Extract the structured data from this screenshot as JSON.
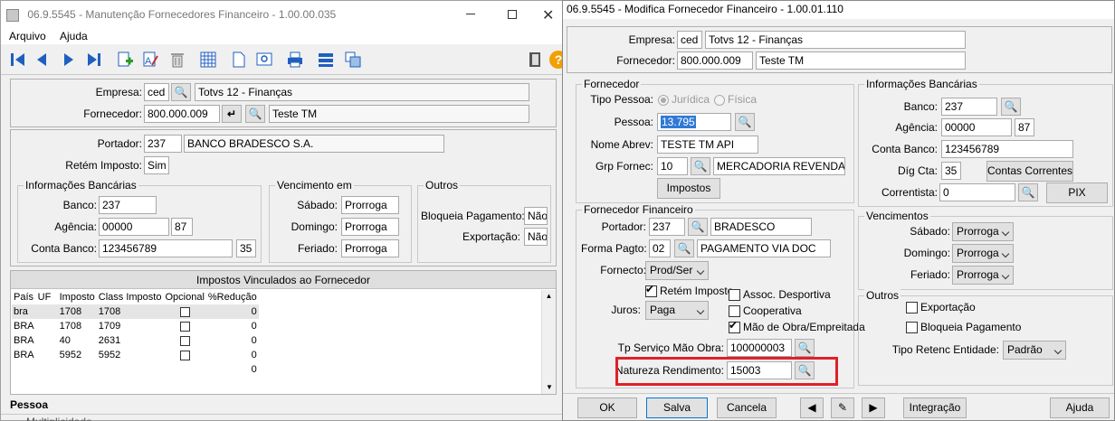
{
  "left": {
    "title": "06.9.5545 - Manutenção Fornecedores Financeiro - 1.00.00.035",
    "menu": [
      "Arquivo",
      "Ajuda"
    ],
    "empresa": {
      "label": "Empresa:",
      "code": "ced",
      "name": "Totvs 12 - Finanças"
    },
    "fornecedor": {
      "label": "Fornecedor:",
      "code": "800.000.009",
      "name": "Teste TM"
    },
    "portador": {
      "label": "Portador:",
      "code": "237",
      "name": "BANCO BRADESCO S.A."
    },
    "retem": {
      "label": "Retém Imposto:",
      "value": "Sim"
    },
    "info_bancarias": {
      "title": "Informações Bancárias",
      "banco_label": "Banco:",
      "banco": "237",
      "agencia_label": "Agência:",
      "agencia": "00000",
      "agencia_dv": "87",
      "conta_label": "Conta Banco:",
      "conta": "123456789",
      "conta_dv": "35"
    },
    "vencimento": {
      "title": "Vencimento em",
      "sabado_label": "Sábado:",
      "sabado": "Prorroga",
      "domingo_label": "Domingo:",
      "domingo": "Prorroga",
      "feriado_label": "Feriado:",
      "feriado": "Prorroga"
    },
    "outros": {
      "title": "Outros",
      "bloqueia_label": "Bloqueia Pagamento:",
      "bloqueia": "Não",
      "exportacao_label": "Exportação:",
      "exportacao": "Não"
    },
    "impostos": {
      "title": "Impostos Vinculados ao Fornecedor",
      "headers": [
        "País",
        "UF",
        "Imposto",
        "Class Imposto",
        "Opcional",
        "%Redução"
      ],
      "rows": [
        {
          "pais": "bra",
          "uf": "",
          "imposto": "1708",
          "classe": "1708",
          "reducao": "0"
        },
        {
          "pais": "BRA",
          "uf": "",
          "imposto": "1708",
          "classe": "1709",
          "reducao": "0"
        },
        {
          "pais": "BRA",
          "uf": "",
          "imposto": "40",
          "classe": "2631",
          "reducao": "0"
        },
        {
          "pais": "BRA",
          "uf": "",
          "imposto": "5952",
          "classe": "5952",
          "reducao": "0"
        }
      ],
      "empty_reducao": "0"
    },
    "bottom_tab": "Pessoa",
    "bottom_cut": "Multiplicidade"
  },
  "right": {
    "title": "06.9.5545 - Modifica Fornecedor Financeiro - 1.00.01.110",
    "empresa": {
      "label": "Empresa:",
      "code": "ced",
      "name": "Totvs 12 - Finanças"
    },
    "fornecedor": {
      "label": "Fornecedor:",
      "code": "800.000.009",
      "name": "Teste TM"
    },
    "fornecedor_group": {
      "title": "Fornecedor",
      "tipo_label": "Tipo Pessoa:",
      "juridica": "Jurídica",
      "fisica": "Física",
      "pessoa_label": "Pessoa:",
      "pessoa": "13.795",
      "nome_label": "Nome Abrev:",
      "nome": "TESTE TM API",
      "grp_label": "Grp Fornec:",
      "grp": "10",
      "grp_name": "MERCADORIA REVENDA-N",
      "impostos_btn": "Impostos"
    },
    "info_bancarias": {
      "title": "Informações Bancárias",
      "banco_label": "Banco:",
      "banco": "237",
      "agencia_label": "Agência:",
      "agencia": "00000",
      "agencia_dv": "87",
      "conta_label": "Conta Banco:",
      "conta": "123456789",
      "dig_label": "Díg Cta:",
      "dig": "35",
      "contas_btn": "Contas Correntes",
      "correntista_label": "Correntista:",
      "correntista": "0",
      "pix_btn": "PIX"
    },
    "fin_group": {
      "title": "Fornecedor Financeiro",
      "portador_label": "Portador:",
      "portador": "237",
      "portador_name": "BRADESCO",
      "forma_label": "Forma Pagto:",
      "forma": "02",
      "forma_name": "PAGAMENTO VIA DOC",
      "fornecto_label": "Fornecto:",
      "fornecto": "Prod/Ser",
      "retem": "Retém Imposto",
      "juros_label": "Juros:",
      "juros": "Paga",
      "assoc": "Assoc. Desportiva",
      "coop": "Cooperativa",
      "mao": "Mão de Obra/Empreitada",
      "tp_label": "Tp Serviço Mão Obra:",
      "tp": "100000003",
      "natureza_label": "Natureza Rendimento:",
      "natureza": "15003"
    },
    "vencimentos": {
      "title": "Vencimentos",
      "sabado_label": "Sábado:",
      "sabado": "Prorroga",
      "domingo_label": "Domingo:",
      "domingo": "Prorroga",
      "feriado_label": "Feriado:",
      "feriado": "Prorroga"
    },
    "outros": {
      "title": "Outros",
      "exportacao": "Exportação",
      "bloqueia": "Bloqueia Pagamento",
      "tipo_label": "Tipo Retenc Entidade:",
      "tipo": "Padrão"
    },
    "buttons": {
      "ok": "OK",
      "salva": "Salva",
      "cancela": "Cancela",
      "integracao": "Integração",
      "ajuda": "Ajuda"
    },
    "highlight_color": "#e0202a"
  }
}
